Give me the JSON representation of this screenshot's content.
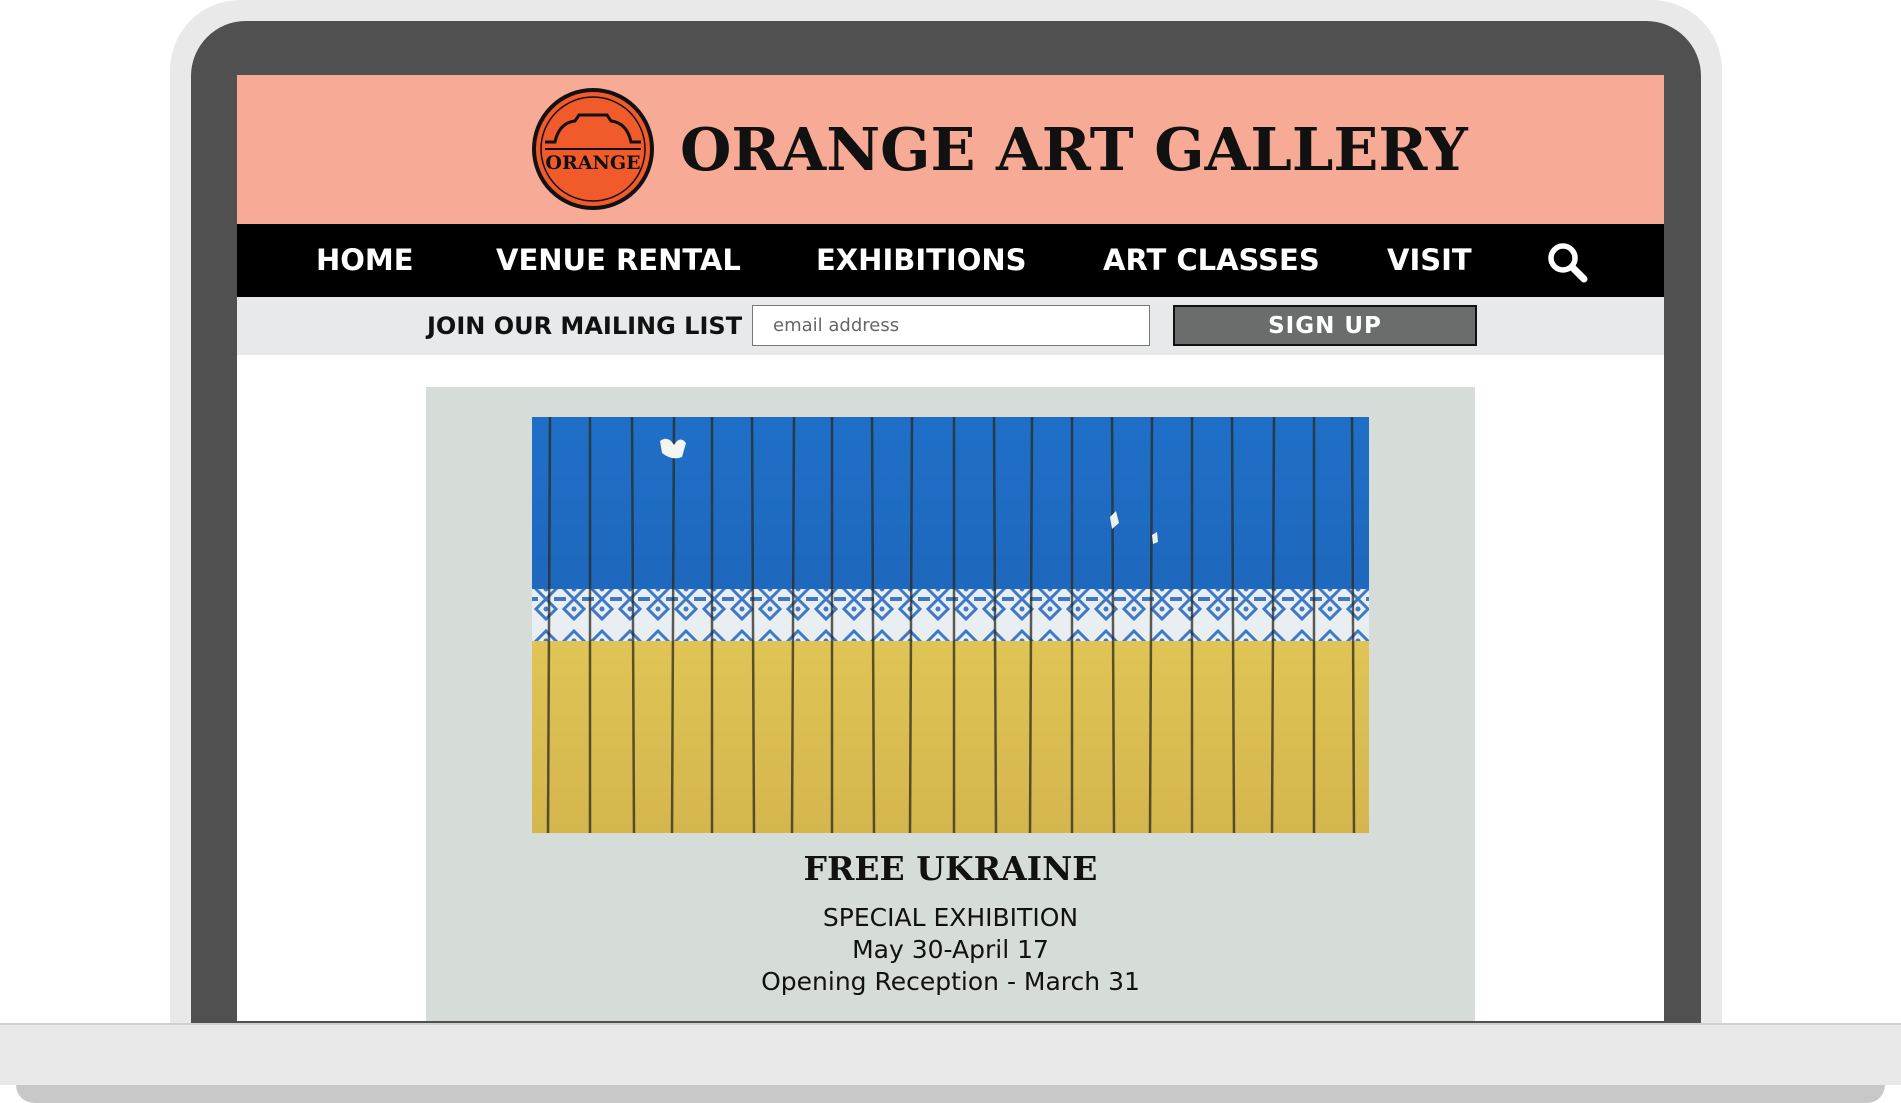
{
  "site": {
    "title": "ORANGE ART GALLERY",
    "logo_text": "ORANGE",
    "colors": {
      "header_bg": "#f7ab96",
      "logo_orange": "#f15a2b",
      "nav_bg": "#000000",
      "feature_bg": "#d6dcd7"
    }
  },
  "nav": {
    "items": [
      {
        "label": "HOME"
      },
      {
        "label": "VENUE RENTAL"
      },
      {
        "label": "EXHIBITIONS"
      },
      {
        "label": "ART CLASSES"
      },
      {
        "label": "VISIT"
      }
    ],
    "search_icon": "search-icon"
  },
  "mailing": {
    "label": "JOIN OUR MAILING LIST",
    "placeholder": "email address",
    "button": "SIGN UP"
  },
  "feature": {
    "image": "ukraine-flag-fence-artwork",
    "title": "FREE UKRAINE",
    "subtitle": "SPECIAL EXHIBITION",
    "dates": "May 30-April 17",
    "reception": "Opening Reception - March 31"
  }
}
